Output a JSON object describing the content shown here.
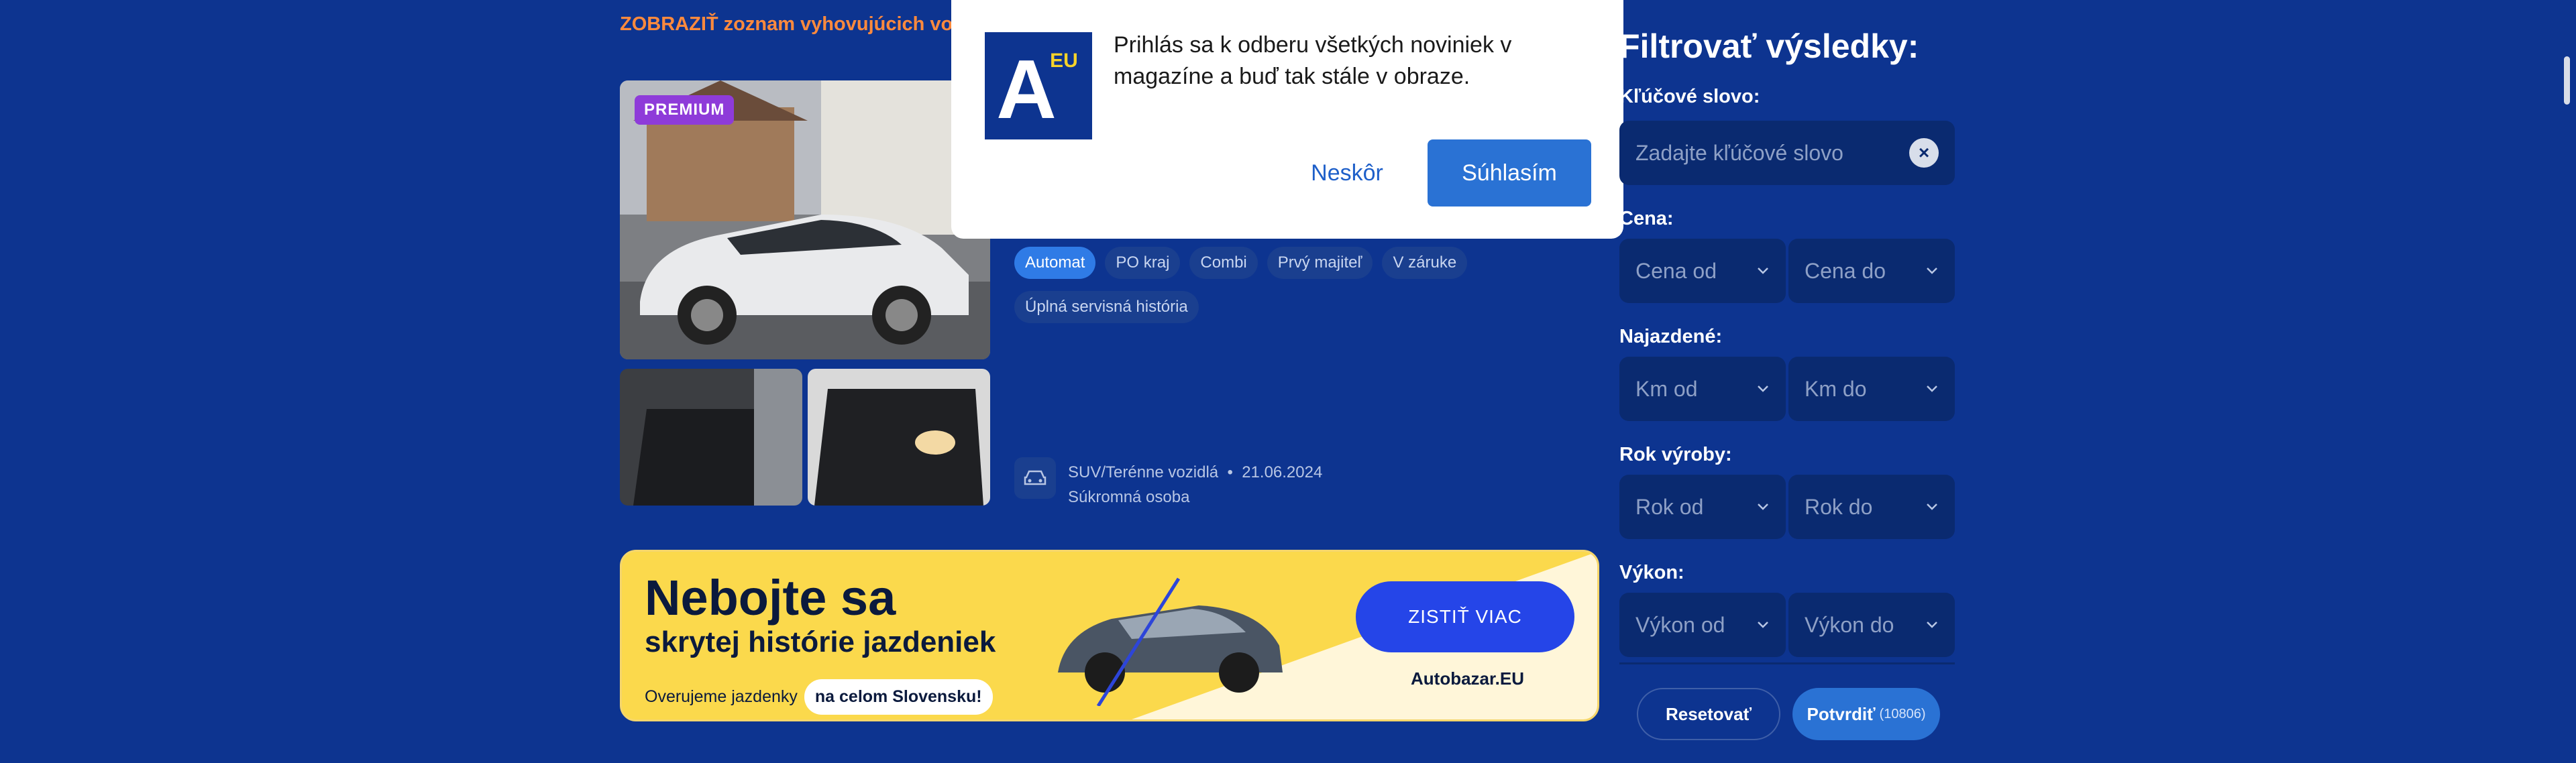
{
  "listing": {
    "show_link": "ZOBRAZIŤ zoznam vyhovujúcich voz",
    "badge": "PREMIUM",
    "tags": [
      "Automat",
      "PO kraj",
      "Combi",
      "Prvý majiteľ",
      "V záruke",
      "Úplná servisná história"
    ],
    "category": "SUV/Terénne vozidlá",
    "date": "21.06.2024",
    "seller": "Súkromná osoba"
  },
  "banner": {
    "title": "Nebojte sa",
    "subtitle": "skrytej histórie jazdeniek",
    "small_text": "Overujeme jazdenky",
    "pill_text": "na celom Slovensku!",
    "button": "ZISTIŤ VIAC",
    "brand": "Autobazar.EU"
  },
  "popup": {
    "logo_letter": "A",
    "logo_eu": "EU",
    "text": "Prihlás sa k odberu všetkých noviniek v magazíne a buď tak stále v obraze.",
    "later": "Neskôr",
    "agree": "Súhlasím"
  },
  "filter": {
    "title": "Filtrovať výsledky:",
    "keyword_label": "Kľúčové slovo:",
    "keyword_placeholder": "Zadajte kľúčové slovo",
    "price_label": "Cena:",
    "price_from": "Cena od",
    "price_to": "Cena do",
    "km_label": "Najazdené:",
    "km_from": "Km od",
    "km_to": "Km do",
    "year_label": "Rok výroby:",
    "year_from": "Rok od",
    "year_to": "Rok do",
    "power_label": "Výkon:",
    "power_from": "Výkon od",
    "power_to": "Výkon do",
    "reset": "Resetovať",
    "confirm": "Potvrdiť",
    "count": "(10806)"
  },
  "colors": {
    "background": "#0d3490",
    "accent_orange": "#ff8a3d",
    "primary_blue": "#2a72d4",
    "banner_yellow": "#fbd94c",
    "premium_purple": "#8e3bd9"
  }
}
